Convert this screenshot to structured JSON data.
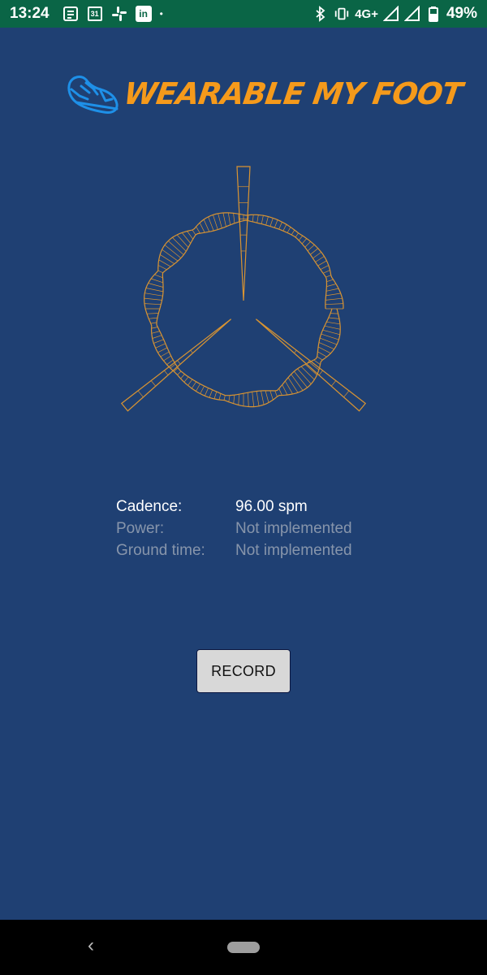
{
  "status_bar": {
    "time": "13:24",
    "network": "4G+",
    "battery": "49%",
    "calendar_day": "31",
    "linkedin_label": "in",
    "notification_dot": "•"
  },
  "app": {
    "logo_text": "WEARABLE MY FOOT",
    "brand_color": "#f59a1b",
    "background_color": "#1f4073"
  },
  "metrics": [
    {
      "label": "Cadence:",
      "value": "96.00 spm"
    },
    {
      "label": "Power:",
      "value": "Not implemented"
    },
    {
      "label": "Ground time:",
      "value": "Not implemented"
    }
  ],
  "record_button": {
    "label": "RECORD"
  },
  "nav": {
    "back_glyph": "‹"
  }
}
